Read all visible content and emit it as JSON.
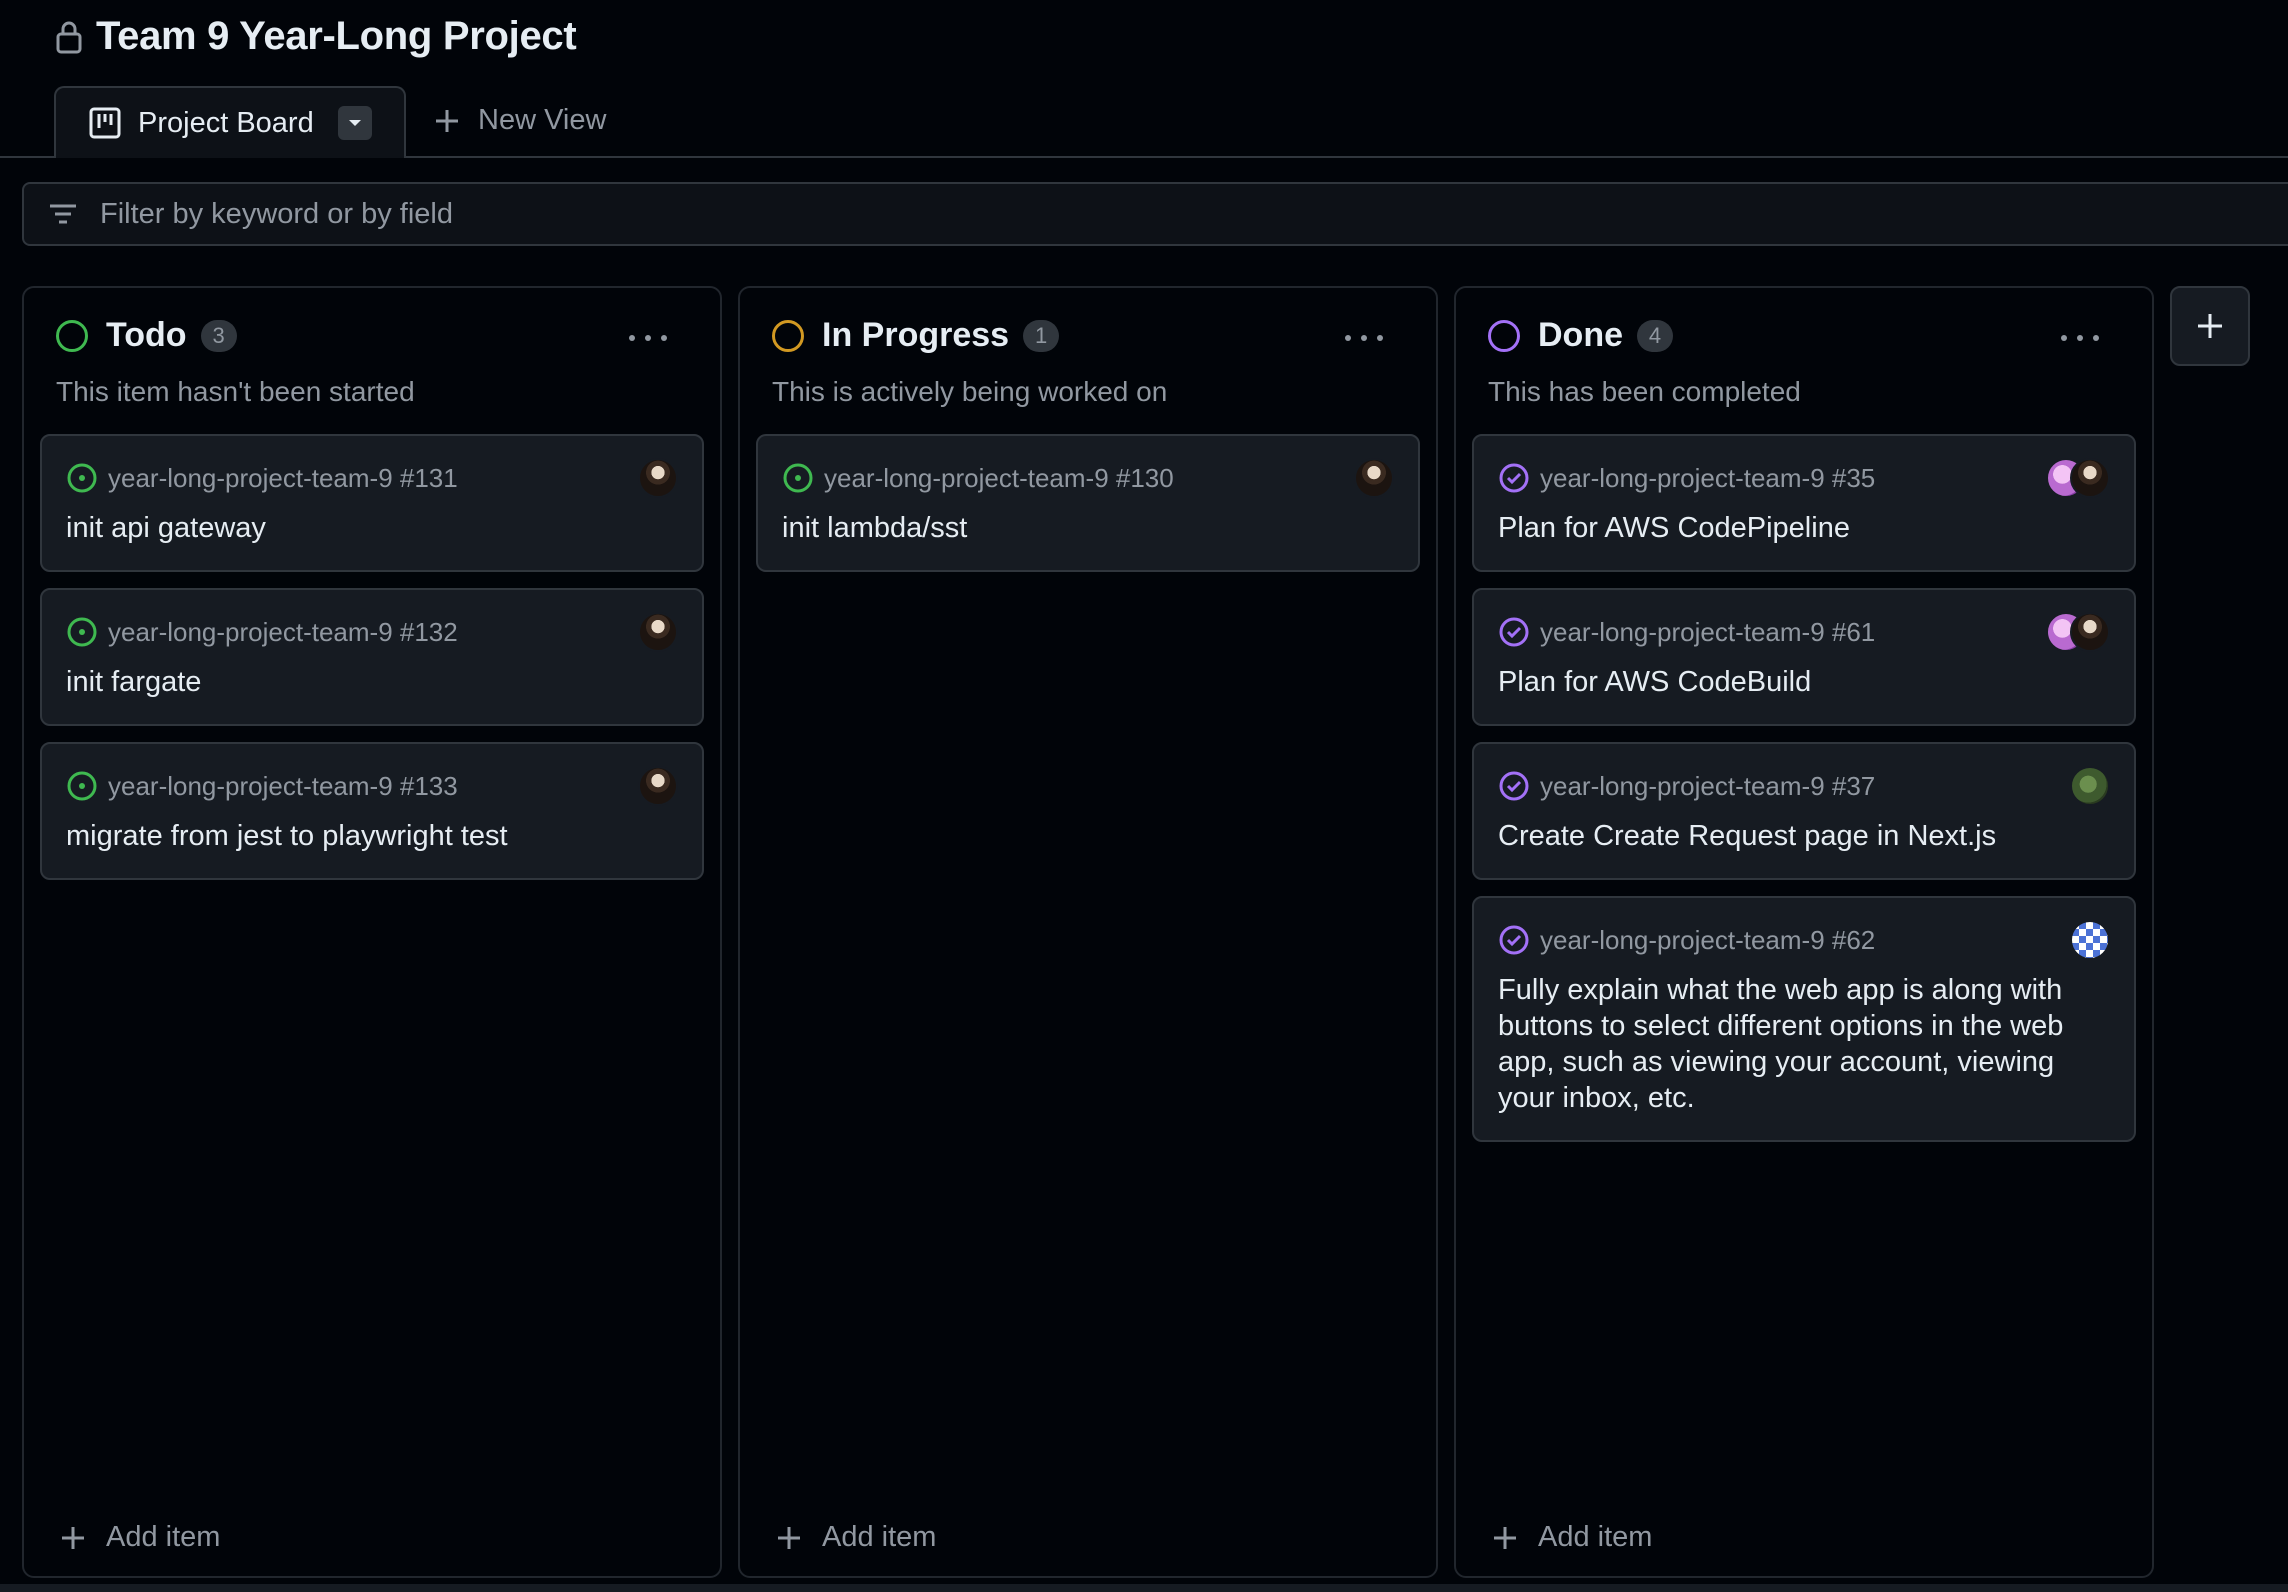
{
  "project": {
    "title": "Team 9 Year-Long Project",
    "lock_icon": "lock-icon"
  },
  "tabs": {
    "active_label": "Project Board",
    "new_view_label": "New View"
  },
  "filter": {
    "placeholder": "Filter by keyword or by field"
  },
  "colors": {
    "todo": "#3fb950",
    "in_progress": "#d29922",
    "done": "#a371f7",
    "muted": "#9198a1"
  },
  "columns": [
    {
      "name": "Todo",
      "count": "3",
      "description": "This item hasn't been started",
      "add_label": "Add item",
      "cards": [
        {
          "ref": "year-long-project-team-9 #131",
          "title": "init api gateway"
        },
        {
          "ref": "year-long-project-team-9 #132",
          "title": "init fargate"
        },
        {
          "ref": "year-long-project-team-9 #133",
          "title": "migrate from jest to playwright test"
        }
      ]
    },
    {
      "name": "In Progress",
      "count": "1",
      "description": "This is actively being worked on",
      "add_label": "Add item",
      "cards": [
        {
          "ref": "year-long-project-team-9 #130",
          "title": "init lambda/sst"
        }
      ]
    },
    {
      "name": "Done",
      "count": "4",
      "description": "This has been completed",
      "add_label": "Add item",
      "cards": [
        {
          "ref": "year-long-project-team-9 #35",
          "title": "Plan for AWS CodePipeline"
        },
        {
          "ref": "year-long-project-team-9 #61",
          "title": "Plan for AWS CodeBuild"
        },
        {
          "ref": "year-long-project-team-9 #37",
          "title": "Create Create Request page in Next.js"
        },
        {
          "ref": "year-long-project-team-9 #62",
          "title": "Fully explain what the web app is along with buttons to select different options in the web app, such as viewing your account, viewing your inbox, etc."
        }
      ]
    }
  ]
}
